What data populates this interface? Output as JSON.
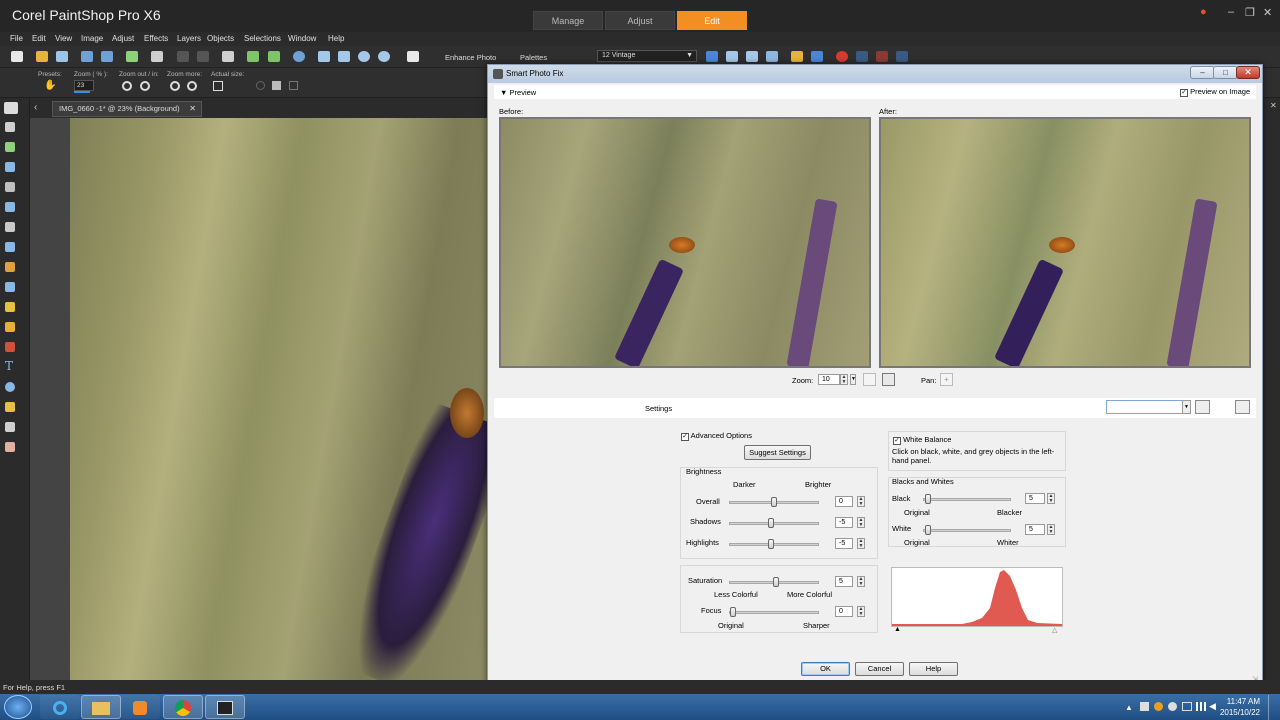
{
  "app": {
    "title": "Corel PaintShop Pro X6",
    "workspace_tabs": [
      "Manage",
      "Adjust",
      "Edit"
    ],
    "active_tab": "Edit",
    "accent": "#f28e22"
  },
  "menu": [
    "File",
    "Edit",
    "View",
    "Image",
    "Adjust",
    "Effects",
    "Layers",
    "Objects",
    "Selections",
    "Window",
    "Help"
  ],
  "toolbar": {
    "enhance_photo": "Enhance Photo",
    "palettes": "Palettes",
    "preset_dropdown": "12 Vintage"
  },
  "tool_options": {
    "presets": "Presets:",
    "zoom_label": "Zoom ( % ):",
    "zoom_value": "23",
    "zoom_out": "Zoom out / in:",
    "zoom_more": "Zoom more:",
    "actual_size": "Actual size:"
  },
  "document": {
    "tab_label": "IMG_0660 -1* @  23% (Background)"
  },
  "dialog": {
    "title": "Smart Photo Fix",
    "preview_label": "Preview",
    "preview_on_image": "Preview on Image",
    "before": "Before:",
    "after": "After:",
    "zoom_label": "Zoom:",
    "zoom_value": "10",
    "pan_label": "Pan:",
    "settings_label": "Settings",
    "advanced_options": "Advanced Options",
    "suggest_settings": "Suggest Settings",
    "brightness": {
      "group": "Brightness",
      "darker": "Darker",
      "brighter": "Brighter",
      "overall_label": "Overall",
      "overall_value": "0",
      "shadows_label": "Shadows",
      "shadows_value": "-5",
      "highlights_label": "Highlights",
      "highlights_value": "-5"
    },
    "saturation": {
      "label": "Saturation",
      "value": "5",
      "less": "Less Colorful",
      "more": "More Colorful"
    },
    "focus": {
      "label": "Focus",
      "value": "0",
      "original": "Original",
      "sharper": "Sharper"
    },
    "white_balance": {
      "label": "White Balance",
      "hint": "Click on black, white, and grey objects in the left-hand panel."
    },
    "blacks_whites": {
      "group": "Blacks and Whites",
      "black_label": "Black",
      "black_value": "5",
      "black_original": "Original",
      "blacker": "Blacker",
      "white_label": "White",
      "white_value": "5",
      "white_original": "Original",
      "whiter": "Whiter"
    },
    "buttons": {
      "ok": "OK",
      "cancel": "Cancel",
      "help": "Help"
    }
  },
  "status": {
    "help_text": "For Help, press F1"
  },
  "clock": {
    "time": "11:47 AM",
    "date": "2015/10/22"
  }
}
